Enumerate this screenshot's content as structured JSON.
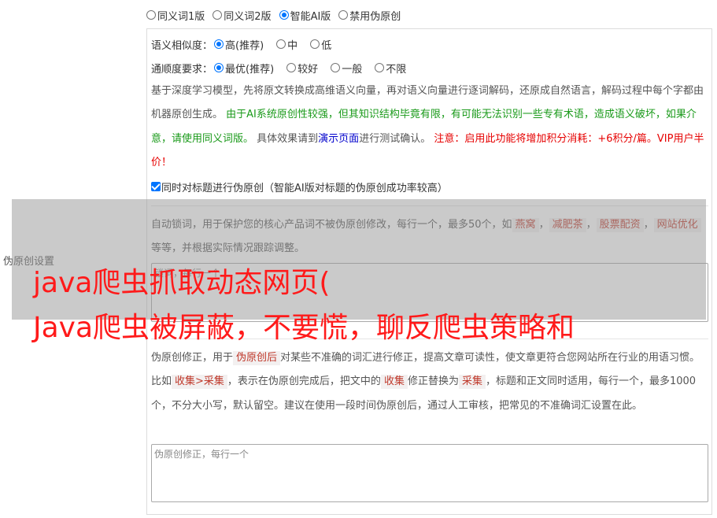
{
  "versions": [
    "同义词1版",
    "同义词2版",
    "智能AI版",
    "禁用伪原创"
  ],
  "selected_version": "智能AI版",
  "settings_label": "伪原创设置",
  "similarity": {
    "label": "语义相似度：",
    "options": [
      "高(推荐)",
      "中",
      "低"
    ],
    "selected": "高(推荐)"
  },
  "fluency": {
    "label": "通顺度要求：",
    "options": [
      "最优(推荐)",
      "较好",
      "一般",
      "不限"
    ],
    "selected": "最优(推荐)"
  },
  "description": {
    "intro": "基于深度学习模型，先将原文转换成高维语义向量，再对语义向量进行逐词解码，还原成自然语言，解码过程中每个字都由机器原创生成。",
    "warning_green": "由于AI系统原创性较强，但其知识结构毕竟有限，有可能无法识别一些专有术语，造成语义破坏，如果介意，请使用同义词版。",
    "test_prefix": "具体效果请到",
    "demo_link": "演示页面",
    "test_suffix": "进行测试确认。",
    "notice_red": "注意：启用此功能将增加积分消耗：+6积分/篇。VIP用户半价！"
  },
  "title_checkbox": {
    "label": "同时对标题进行伪原创（智能AI版对标题的伪原创成功率较高）",
    "checked": true
  },
  "lock_words": {
    "prefix": "自动锁词，用于保护您的核心产品词不被伪原创修改，每行一个，最多50个，如",
    "examples": [
      "燕窝",
      "减肥茶",
      "股票配资",
      "网站优化"
    ],
    "suffix": "等等，并根据实际情况跟踪调整。",
    "separator": "，",
    "placeholder": "锁词，每行一个"
  },
  "correction": {
    "p1": "伪原创修正，用于",
    "kw1": "伪原创后",
    "p2": "对某些不准确的词汇进行修正，提高文章可读性，使文章更符合您网站所在行业的用语习惯。比如",
    "kw2": "收集>采集",
    "p3": "，表示在伪原创完成后，把文中的",
    "kw3": "收集",
    "p4": "修正替换为",
    "kw4": "采集",
    "p5": "，标题和正文同时适用，每行一个，最多1000个，不分大小写，默认留空。建议在使用一段时间伪原创后，通过人工审核，把常见的不准确词汇设置在此。",
    "placeholder": "伪原创修正，每行一个"
  },
  "headline": {
    "line1": "java爬虫抓取动态网页(",
    "line2": "Java爬虫被屏蔽，不要慌，聊反爬虫策略和"
  },
  "colors": {
    "accent": "#0075ff",
    "red_text": "#ff1a1a",
    "green_text": "#1a9a1a",
    "overlay": "#969696"
  }
}
